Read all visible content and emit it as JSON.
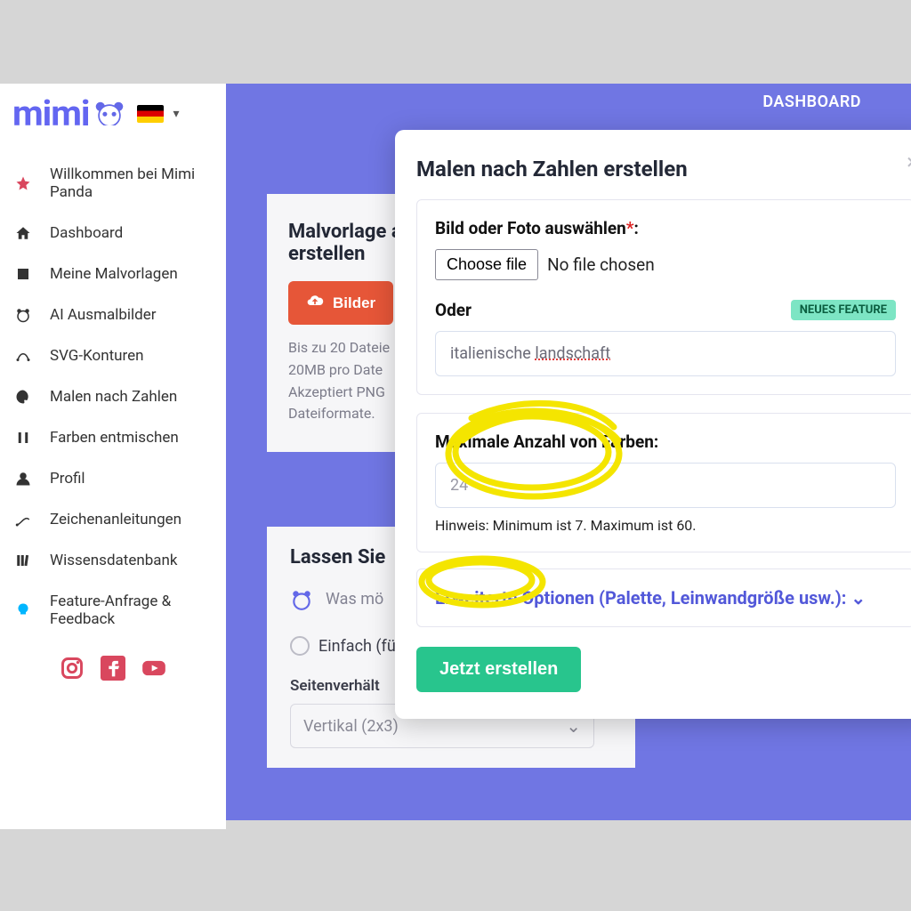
{
  "logo": {
    "text": "mimi"
  },
  "topbar": {
    "label": "DASHBOARD"
  },
  "sidebar": {
    "items": [
      {
        "label": "Willkommen bei Mimi Panda"
      },
      {
        "label": "Dashboard"
      },
      {
        "label": "Meine Malvorlagen"
      },
      {
        "label": "AI Ausmalbilder"
      },
      {
        "label": "SVG-Konturen"
      },
      {
        "label": "Malen nach Zahlen"
      },
      {
        "label": "Farben entmischen"
      },
      {
        "label": "Profil"
      },
      {
        "label": "Zeichenanleitungen"
      },
      {
        "label": "Wissensdatenbank"
      },
      {
        "label": "Feature-Anfrage & Feedback"
      }
    ]
  },
  "card": {
    "title": "Malvorlage a\nerstellen",
    "title_line1": "Malvorlage a",
    "title_line2": "erstellen",
    "button_label": "Bilder",
    "help_line1": "Bis zu 20 Dateie",
    "help_line2": "20MB pro Date",
    "help_line3": "Akzeptiert PNG",
    "help_line4": "Dateiformate."
  },
  "card2": {
    "title": "Lassen Sie",
    "prompt_placeholder": "Was mö",
    "radio_label": "Einfach (fü",
    "aspect_label": "Seitenverhält",
    "select_value": "Vertikal (2x3)"
  },
  "modal": {
    "title": "Malen nach Zahlen erstellen",
    "section1_label": "Bild oder Foto auswählen",
    "file_button": "Choose file",
    "file_status": "No file chosen",
    "oder": "Oder",
    "badge": "NEUES FEATURE",
    "text_input_value_a": "italienische ",
    "text_input_value_b": "landschaft",
    "section2_label": "Maximale Anzahl von Farben:",
    "colors_value": "24",
    "colors_hint": "Hinweis: Minimum ist 7. Maximum ist 60.",
    "adv_label": "Erweiterte Optionen (Palette, Leinwandgröße usw.):",
    "submit_label": "Jetzt erstellen"
  }
}
